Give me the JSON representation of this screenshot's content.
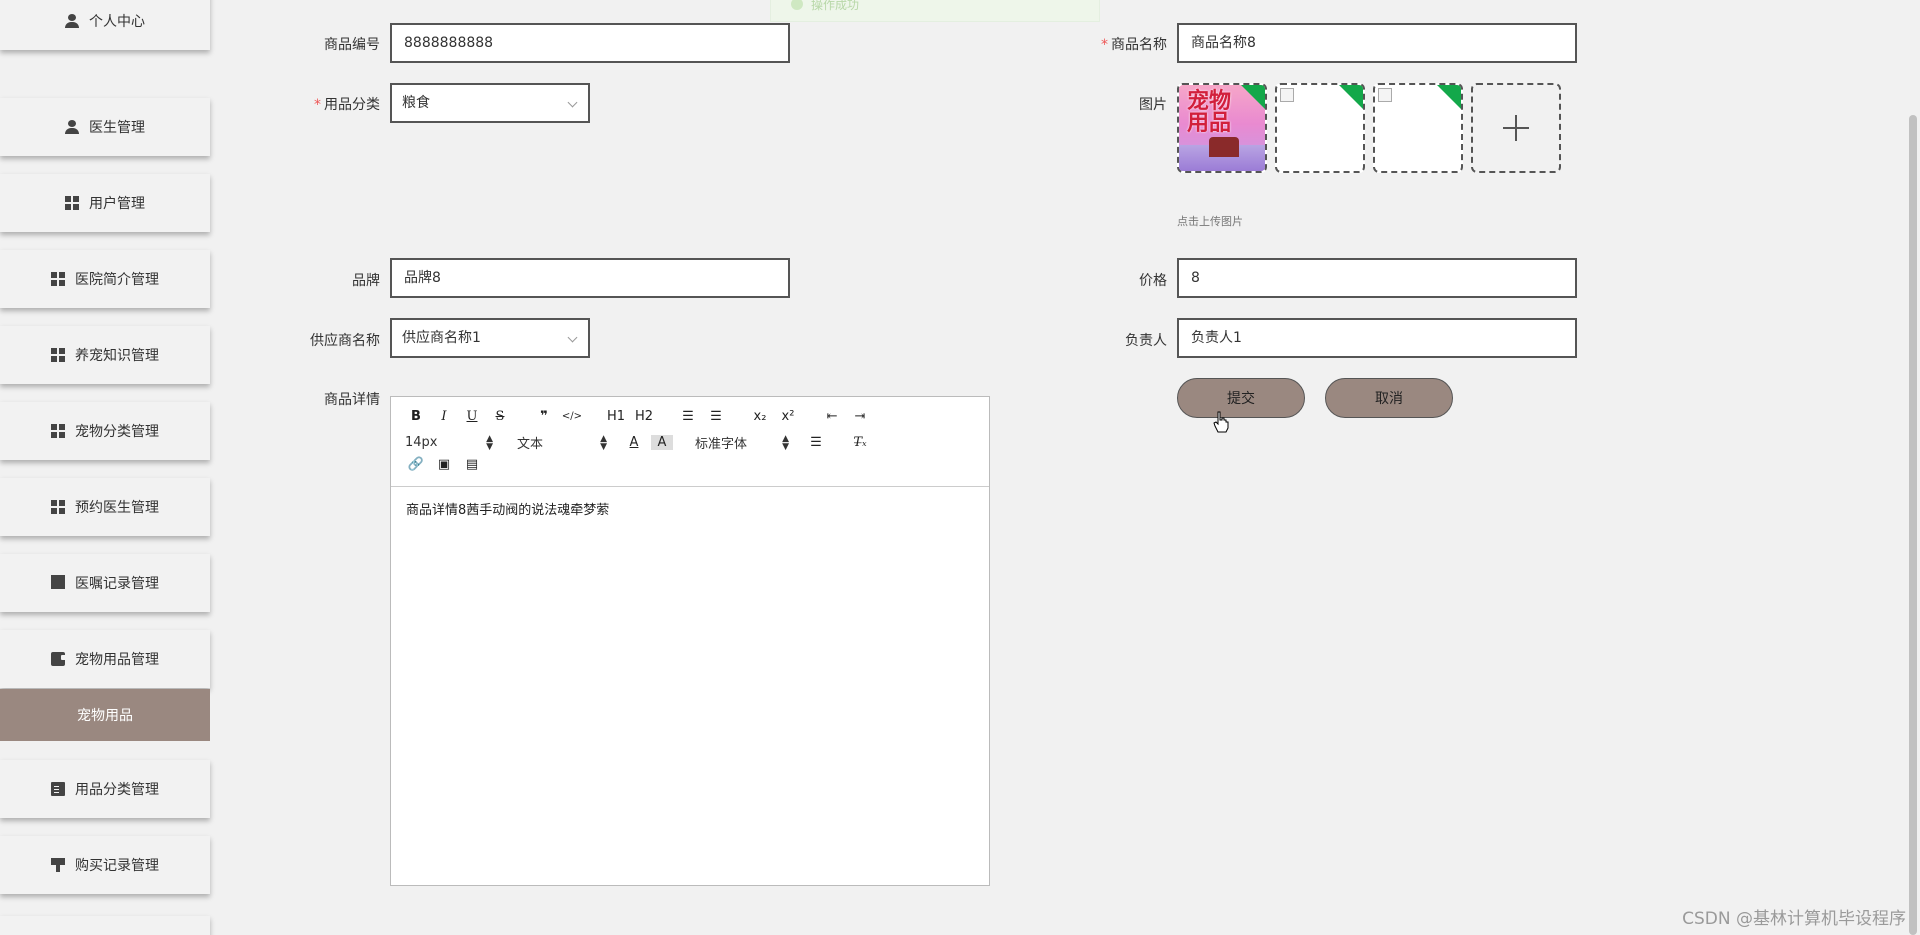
{
  "toast": {
    "text": "操作成功"
  },
  "sidebar": {
    "items": [
      {
        "label": "个人中心",
        "icon": "user-icon"
      },
      {
        "label": "医生管理",
        "icon": "user-icon"
      },
      {
        "label": "用户管理",
        "icon": "grid-icon"
      },
      {
        "label": "医院简介管理",
        "icon": "grid-icon"
      },
      {
        "label": "养宠知识管理",
        "icon": "grid-icon"
      },
      {
        "label": "宠物分类管理",
        "icon": "grid-icon"
      },
      {
        "label": "预约医生管理",
        "icon": "grid-icon"
      },
      {
        "label": "医嘱记录管理",
        "icon": "monitor-icon"
      },
      {
        "label": "宠物用品管理",
        "icon": "wallet-icon"
      },
      {
        "label": "宠物用品",
        "icon": "",
        "active_sub": true
      },
      {
        "label": "用品分类管理",
        "icon": "clipboard-icon"
      },
      {
        "label": "购买记录管理",
        "icon": "stamp-icon"
      }
    ],
    "active_color": "#9a8880"
  },
  "form": {
    "code": {
      "label": "商品编号",
      "value": "8888888888"
    },
    "name": {
      "label": "商品名称",
      "value": "商品名称8",
      "required": true
    },
    "category": {
      "label": "用品分类",
      "value": "粮食",
      "required": true
    },
    "image": {
      "label": "图片",
      "hint": "点击上传图片",
      "poster_text": "宠物\n用品"
    },
    "brand": {
      "label": "品牌",
      "value": "品牌8"
    },
    "price": {
      "label": "价格",
      "value": "8"
    },
    "supplier": {
      "label": "供应商名称",
      "value": "供应商名称1"
    },
    "manager": {
      "label": "负责人",
      "value": "负责人1"
    },
    "detail": {
      "label": "商品详情",
      "value": "商品详情8茜手动阀的说法魂牵梦萦"
    }
  },
  "editor_toolbar": {
    "row1": [
      "B",
      "I",
      "U",
      "S",
      "❞",
      "</>",
      "H1",
      "H2",
      "ordered-list-icon",
      "bullet-list-icon",
      "x₂",
      "x²",
      "outdent-icon",
      "indent-icon"
    ],
    "size_value": "14px",
    "header_value": "文本",
    "font_value": "标准字体"
  },
  "buttons": {
    "submit": "提交",
    "cancel": "取消"
  },
  "watermark": "CSDN @基林计算机毕设程序",
  "colors": {
    "accent": "#9a8880",
    "success": "#13a84a",
    "required": "#e55555"
  }
}
